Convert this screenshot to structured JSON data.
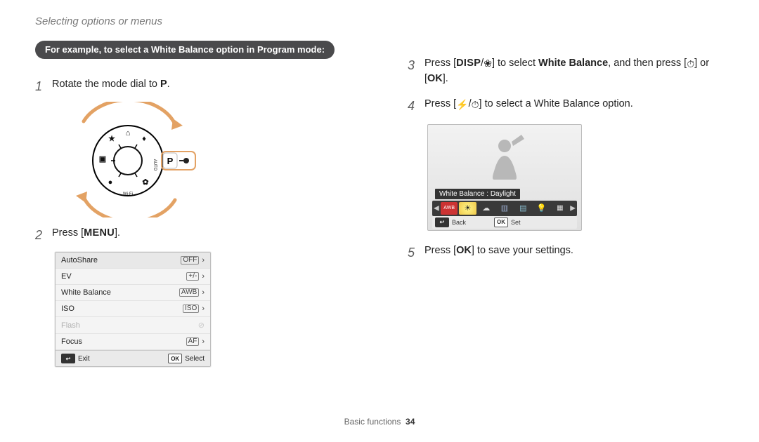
{
  "breadcrumb": "Selecting options or menus",
  "left": {
    "bubble": "For example, to select a White Balance option in Program mode:",
    "step1": {
      "num": "1",
      "pre": "Rotate the mode dial to ",
      "mode": "P",
      "post": "."
    },
    "dial_label": "P",
    "wifi_label": "Wi-Fi",
    "auto_label": "AUTO",
    "step2": {
      "num": "2",
      "pre": "Press [",
      "btn": "MENU",
      "post": "]."
    },
    "menu": {
      "rows": [
        {
          "label": "AutoShare",
          "icon": "OFF"
        },
        {
          "label": "EV",
          "icon": "+/-"
        },
        {
          "label": "White Balance",
          "icon": "AWB"
        },
        {
          "label": "ISO",
          "icon": "ISO"
        },
        {
          "label": "Flash",
          "icon": "⊘"
        },
        {
          "label": "Focus",
          "icon": "AF"
        }
      ],
      "footer": {
        "back_icon": "↩",
        "back": "Exit",
        "ok_icon": "OK",
        "select": "Select"
      }
    }
  },
  "right": {
    "step3": {
      "num": "3",
      "t1": "Press [",
      "disp": "DISP",
      "slash": "/",
      "macro": "❀",
      "t2": "] to select ",
      "bold": "White Balance",
      "t3": ", and then press [",
      "timer": "⏱",
      "t4": "] or [",
      "ok": "OK",
      "t5": "]."
    },
    "step4": {
      "num": "4",
      "t1": "Press [",
      "flash": "⚡",
      "slash": "/",
      "timer": "⏱",
      "t2": "] to select a White Balance option."
    },
    "wb_label": "White Balance : Daylight",
    "wb_footer": {
      "back_icon": "↩",
      "back": "Back",
      "ok_icon": "OK",
      "set": "Set"
    },
    "step5": {
      "num": "5",
      "t1": "Press [",
      "ok": "OK",
      "t2": "] to save your settings."
    }
  },
  "page": {
    "section": "Basic functions",
    "num": "34"
  },
  "colors": {
    "gold": "#d6a25e",
    "sun": "#f0c94b",
    "green": "#86c36a",
    "blue": "#79b7e8",
    "bulb": "#ead064"
  }
}
